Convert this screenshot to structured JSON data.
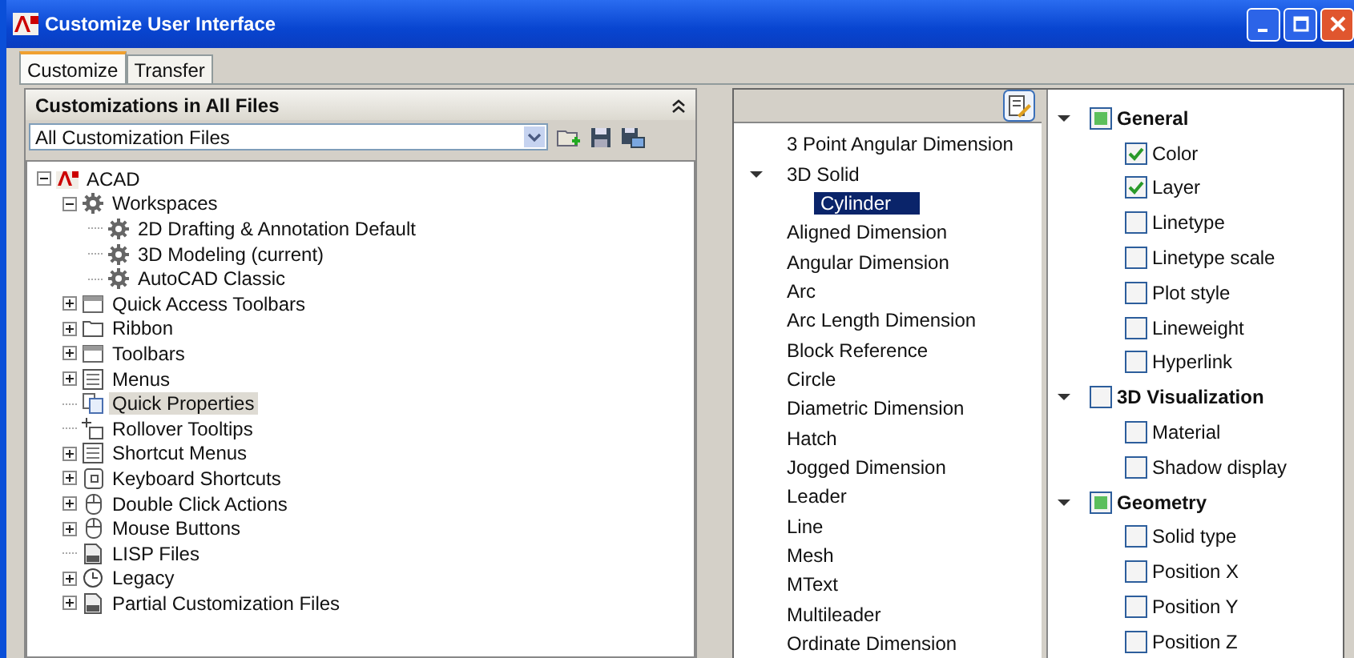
{
  "window": {
    "title": "Customize User Interface"
  },
  "tabs": [
    {
      "label": "Customize",
      "selected": true
    },
    {
      "label": "Transfer",
      "selected": false
    }
  ],
  "left_panel": {
    "title": "Customizations in All Files",
    "file_select": {
      "value": "All Customization Files"
    },
    "tree": [
      {
        "label": "ACAD",
        "kind": "app",
        "expanded": true,
        "selected": false,
        "children": [
          {
            "label": "Workspaces",
            "kind": "gears",
            "expanded": true,
            "selected": false,
            "children": [
              {
                "label": "2D Drafting & Annotation Default",
                "kind": "gear",
                "selected": false
              },
              {
                "label": "3D Modeling (current)",
                "kind": "gear",
                "selected": false
              },
              {
                "label": "AutoCAD Classic",
                "kind": "gear",
                "selected": false
              }
            ]
          },
          {
            "label": "Quick Access Toolbars",
            "kind": "toolbar",
            "expanded": false,
            "selected": false
          },
          {
            "label": "Ribbon",
            "kind": "folder",
            "expanded": false,
            "selected": false
          },
          {
            "label": "Toolbars",
            "kind": "toolbar",
            "expanded": false,
            "selected": false
          },
          {
            "label": "Menus",
            "kind": "menu",
            "expanded": false,
            "selected": false
          },
          {
            "label": "Quick Properties",
            "kind": "properties",
            "selected": true
          },
          {
            "label": "Rollover Tooltips",
            "kind": "tooltip",
            "selected": false
          },
          {
            "label": "Shortcut Menus",
            "kind": "menu",
            "expanded": false,
            "selected": false
          },
          {
            "label": "Keyboard Shortcuts",
            "kind": "keyboard",
            "expanded": false,
            "selected": false
          },
          {
            "label": "Double Click Actions",
            "kind": "mouse",
            "expanded": false,
            "selected": false
          },
          {
            "label": "Mouse Buttons",
            "kind": "mouse",
            "expanded": false,
            "selected": false
          },
          {
            "label": "LISP Files",
            "kind": "file",
            "selected": false
          },
          {
            "label": "Legacy",
            "kind": "clock",
            "expanded": false,
            "selected": false
          },
          {
            "label": "Partial Customization Files",
            "kind": "file",
            "expanded": false,
            "selected": false
          }
        ]
      }
    ]
  },
  "object_types": [
    {
      "label": "3 Point Angular Dimension",
      "selected": false
    },
    {
      "label": "3D Solid",
      "selected": false,
      "expanded": true,
      "children": [
        {
          "label": "Cylinder",
          "selected": true
        }
      ]
    },
    {
      "label": "Aligned Dimension",
      "selected": false
    },
    {
      "label": "Angular Dimension",
      "selected": false
    },
    {
      "label": "Arc",
      "selected": false
    },
    {
      "label": "Arc Length Dimension",
      "selected": false
    },
    {
      "label": "Block Reference",
      "selected": false
    },
    {
      "label": "Circle",
      "selected": false
    },
    {
      "label": "Diametric Dimension",
      "selected": false
    },
    {
      "label": "Hatch",
      "selected": false
    },
    {
      "label": "Jogged Dimension",
      "selected": false
    },
    {
      "label": "Leader",
      "selected": false
    },
    {
      "label": "Line",
      "selected": false
    },
    {
      "label": "Mesh",
      "selected": false
    },
    {
      "label": "MText",
      "selected": false
    },
    {
      "label": "Multileader",
      "selected": false
    },
    {
      "label": "Ordinate Dimension",
      "selected": false
    }
  ],
  "property_groups": [
    {
      "label": "General",
      "checked": false,
      "partial": true,
      "expanded": true,
      "properties": [
        {
          "label": "Color",
          "checked": true
        },
        {
          "label": "Layer",
          "checked": true
        },
        {
          "label": "Linetype",
          "checked": false
        },
        {
          "label": "Linetype scale",
          "checked": false
        },
        {
          "label": "Plot style",
          "checked": false
        },
        {
          "label": "Lineweight",
          "checked": false
        },
        {
          "label": "Hyperlink",
          "checked": false
        }
      ]
    },
    {
      "label": "3D Visualization",
      "checked": false,
      "partial": false,
      "expanded": true,
      "properties": [
        {
          "label": "Material",
          "checked": false
        },
        {
          "label": "Shadow display",
          "checked": false
        }
      ]
    },
    {
      "label": "Geometry",
      "checked": false,
      "partial": true,
      "expanded": true,
      "properties": [
        {
          "label": "Solid type",
          "checked": false
        },
        {
          "label": "Position X",
          "checked": false
        },
        {
          "label": "Position Y",
          "checked": false
        },
        {
          "label": "Position Z",
          "checked": false
        }
      ]
    }
  ]
}
